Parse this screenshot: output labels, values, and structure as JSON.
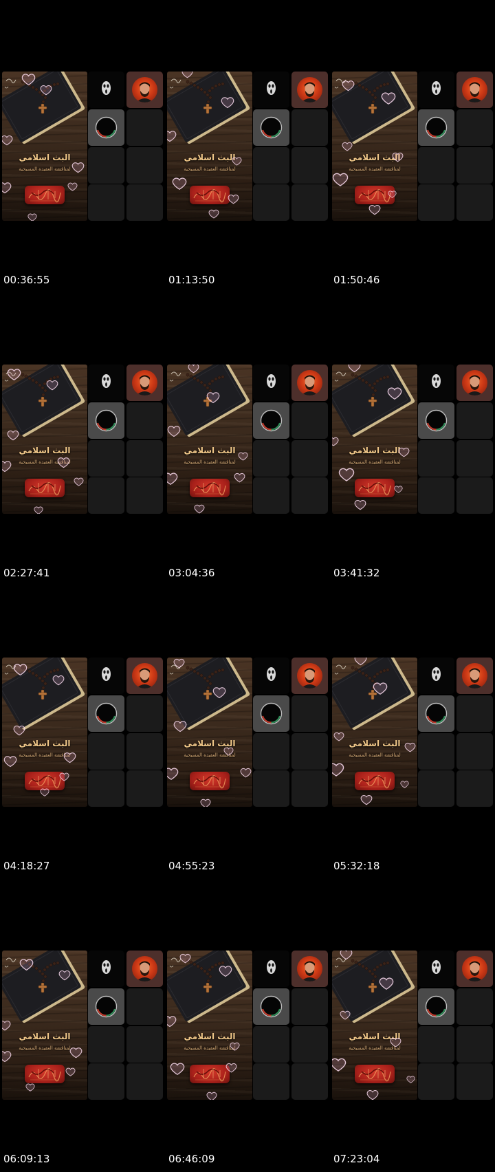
{
  "poster": {
    "title": "البث اسلامي",
    "subtitle": "لمناقشة العقيدة المسيحية"
  },
  "colors": {
    "background": "#000000",
    "poster_title": "#f2c98a",
    "emblem_red": "#a8201a",
    "host_tile": "#4d2f2b",
    "logo_tile": "#4a4a4a",
    "empty_tile": "#1b1b1b",
    "timestamp_text": "#ffffff"
  },
  "icons": {
    "participant_1": "mask-icon",
    "participant_2": "host-avatar",
    "participant_3": "logo-ring-icon",
    "decoration": "heart-bubble-icon"
  },
  "frames": [
    {
      "timestamp": "00:36:55"
    },
    {
      "timestamp": "01:13:50"
    },
    {
      "timestamp": "01:50:46"
    },
    {
      "timestamp": "02:27:41"
    },
    {
      "timestamp": "03:04:36"
    },
    {
      "timestamp": "03:41:32"
    },
    {
      "timestamp": "04:18:27"
    },
    {
      "timestamp": "04:55:23"
    },
    {
      "timestamp": "05:32:18"
    },
    {
      "timestamp": "06:09:13"
    },
    {
      "timestamp": "06:46:09"
    },
    {
      "timestamp": "07:23:04"
    }
  ]
}
